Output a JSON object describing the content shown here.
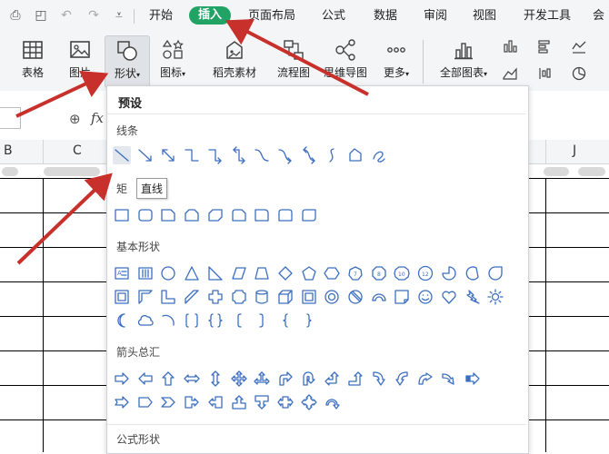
{
  "menubar": {
    "quick_access": [
      {
        "name": "print-icon",
        "glyph": "⎙"
      },
      {
        "name": "print-preview-icon",
        "glyph": "◰"
      },
      {
        "name": "undo-icon",
        "glyph": "↶"
      },
      {
        "name": "redo-icon",
        "glyph": "↷"
      },
      {
        "name": "customize-icon",
        "glyph": "⩡"
      }
    ],
    "tabs": [
      {
        "label": "开始",
        "active": false
      },
      {
        "label": "插入",
        "active": true
      },
      {
        "label": "页面布局",
        "active": false
      },
      {
        "label": "公式",
        "active": false
      },
      {
        "label": "数据",
        "active": false
      },
      {
        "label": "审阅",
        "active": false
      },
      {
        "label": "视图",
        "active": false
      },
      {
        "label": "开发工具",
        "active": false
      },
      {
        "label": "会",
        "active": false
      }
    ]
  },
  "ribbon": {
    "buttons": [
      {
        "label": "表格",
        "icon": "table-icon"
      },
      {
        "label": "图片",
        "icon": "picture-icon"
      },
      {
        "label": "形状",
        "icon": "shapes-icon",
        "selected": true
      },
      {
        "label": "图标",
        "icon": "icons-icon"
      },
      {
        "label": "稻壳素材",
        "icon": "material-icon"
      },
      {
        "label": "流程图",
        "icon": "flowchart-icon"
      },
      {
        "label": "思维导图",
        "icon": "mindmap-icon"
      },
      {
        "label": "更多",
        "icon": "more-icon"
      },
      {
        "label": "全部图表",
        "icon": "all-charts-icon"
      }
    ]
  },
  "formula": {
    "fx": "fx"
  },
  "columns": [
    "B",
    "C",
    "J"
  ],
  "dropdown": {
    "title": "预设",
    "sections": {
      "lines": "线条",
      "rect": "矩",
      "basic": "基本形状",
      "arrows": "箭头总汇",
      "formula": "公式形状"
    },
    "tooltip": "直线"
  },
  "colors": {
    "accent": "#21a366",
    "arrow": "#c8302c",
    "shape_stroke": "#3d6fbf"
  }
}
